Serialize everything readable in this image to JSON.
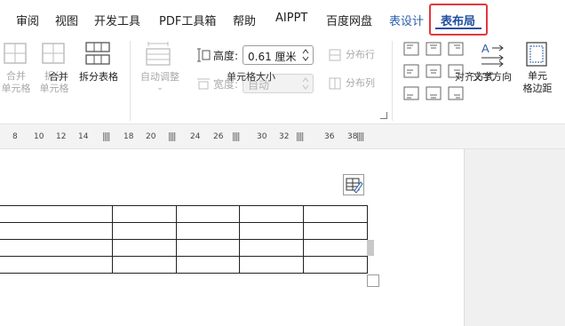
{
  "menu_tabs": [
    {
      "label": "审阅"
    },
    {
      "label": "视图"
    },
    {
      "label": "开发工具"
    },
    {
      "label": "PDF工具箱"
    },
    {
      "label": "帮助"
    },
    {
      "label": "AIPPT"
    },
    {
      "label": "百度网盘"
    },
    {
      "label": "表设计"
    },
    {
      "label": "表布局",
      "active": true
    }
  ],
  "ribbon": {
    "merge_group": {
      "label": "合并",
      "merge_cells": "合并\n单元格",
      "split_cells": "拆分\n单元格",
      "split_table": "拆分表格"
    },
    "cell_size_group": {
      "label": "单元格大小",
      "autofit": "自动调整",
      "height_label": "高度:",
      "height_value": "0.61 厘米",
      "width_label": "宽度:",
      "width_value": "自动",
      "distribute_rows": "分布行",
      "distribute_cols": "分布列"
    },
    "alignment_group": {
      "label": "对齐方式",
      "text_direction": "文字方向",
      "cell_margins": "单元\n格边距"
    }
  },
  "ruler": {
    "numbers": [
      "8",
      "10",
      "12",
      "14",
      "18",
      "20",
      "24",
      "26",
      "30",
      "32",
      "36",
      "38"
    ]
  },
  "table": {
    "rows": 4,
    "cols": 5
  },
  "colors": {
    "active_tab_outline": "#e0393e",
    "active_tab_text": "#1f4fa0",
    "accent_blue": "#2b5faa"
  }
}
